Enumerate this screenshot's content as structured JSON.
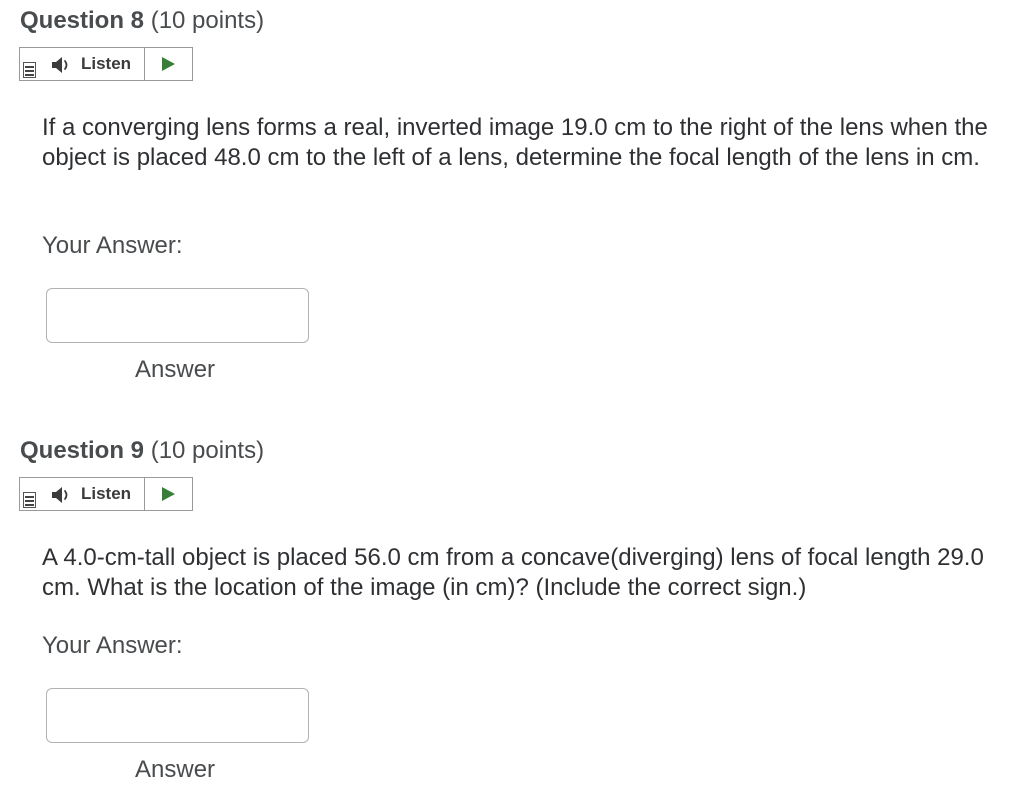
{
  "questions": [
    {
      "label": "Question 8",
      "points": "(10 points)",
      "listen_label": "Listen",
      "text": "If a converging lens forms a real, inverted image 19.0 cm to the right of the lens when the object is placed 48.0 cm to the left of a lens, determine the focal length of the lens in cm.",
      "your_answer_label": "Your Answer:",
      "answer_value": "",
      "answer_caption": "Answer"
    },
    {
      "label": "Question 9",
      "points": "(10 points)",
      "listen_label": "Listen",
      "text": "A 4.0-cm-tall object is placed 56.0 cm from a concave(diverging) lens of focal length 29.0 cm. What is the location of the image (in cm)? (Include the correct sign.)",
      "your_answer_label": "Your Answer:",
      "answer_value": "",
      "answer_caption": "Answer"
    }
  ],
  "icons": {
    "menu": "menu-icon",
    "speaker": "speaker-icon",
    "play": "play-icon"
  },
  "colors": {
    "text": "#494c4e",
    "play_green": "#3a7d3a",
    "border": "#9a9a9a"
  }
}
